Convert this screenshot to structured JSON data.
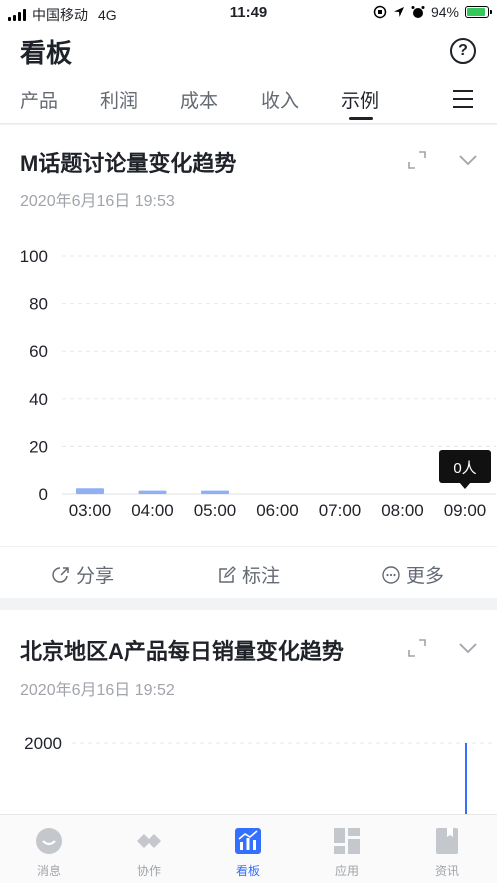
{
  "status_bar": {
    "carrier": "中国移动",
    "network": "4G",
    "time": "11:49",
    "battery": "94%",
    "battery_level": 0.94
  },
  "header": {
    "title": "看板",
    "help_glyph": "?"
  },
  "tabs": [
    {
      "label": "产品",
      "active": false
    },
    {
      "label": "利润",
      "active": false
    },
    {
      "label": "成本",
      "active": false
    },
    {
      "label": "收入",
      "active": false
    },
    {
      "label": "示例",
      "active": true
    }
  ],
  "cards": [
    {
      "title": "M话题讨论量变化趋势",
      "timestamp": "2020年6月16日  19:53",
      "tooltip": "0人",
      "actions": [
        {
          "label": "分享",
          "icon": "share-icon"
        },
        {
          "label": "标注",
          "icon": "annotate-icon"
        },
        {
          "label": "更多",
          "icon": "more-icon"
        }
      ]
    },
    {
      "title": "北京地区A产品每日销量变化趋势",
      "timestamp": "2020年6月16日  19:52"
    }
  ],
  "chart_data": [
    {
      "type": "bar",
      "categories": [
        "03:00",
        "04:00",
        "05:00",
        "06:00",
        "07:00",
        "08:00",
        "09:00"
      ],
      "values": [
        2,
        1,
        1,
        0,
        0,
        0,
        0
      ],
      "yticks": [
        0,
        20,
        40,
        60,
        80,
        100
      ],
      "ylim": [
        0,
        100
      ],
      "grid": true,
      "color": "#8fb0f5",
      "tooltip_category": "09:00"
    },
    {
      "type": "bar",
      "yticks": [
        2000
      ],
      "grid": true,
      "color": "#3370ff"
    }
  ],
  "tabbar": [
    {
      "label": "消息",
      "icon": "message-icon",
      "active": false
    },
    {
      "label": "协作",
      "icon": "collaborate-icon",
      "active": false
    },
    {
      "label": "看板",
      "icon": "dashboard-icon",
      "active": true
    },
    {
      "label": "应用",
      "icon": "apps-icon",
      "active": false
    },
    {
      "label": "资讯",
      "icon": "news-icon",
      "active": false
    }
  ],
  "colors": {
    "accent": "#3370ff",
    "battery": "#34c759"
  }
}
